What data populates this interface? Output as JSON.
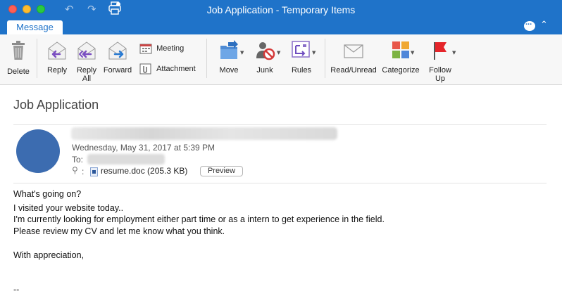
{
  "window": {
    "title": "Job Application - Temporary Items"
  },
  "titlebar_icons": {
    "undo": "undo-icon",
    "redo": "redo-icon",
    "print": "print-icon"
  },
  "tabs": [
    {
      "label": "Message"
    }
  ],
  "ribbon": {
    "delete": "Delete",
    "reply": "Reply",
    "reply_all_1": "Reply",
    "reply_all_2": "All",
    "forward": "Forward",
    "meeting": "Meeting",
    "attachment": "Attachment",
    "move": "Move",
    "junk": "Junk",
    "rules": "Rules",
    "read_unread": "Read/Unread",
    "categorize": "Categorize",
    "follow_up_1": "Follow",
    "follow_up_2": "Up"
  },
  "message": {
    "subject": "Job Application",
    "date": "Wednesday, May 31, 2017 at 5:39 PM",
    "to_label": "To:",
    "attachment_colon": ":",
    "attachment_name": "resume.doc (205.3 KB)",
    "preview_label": "Preview",
    "body": [
      "What's going on?",
      "I visited your website today..",
      "I'm currently looking for employment either part time or as a intern to get experience in the field.",
      "Please review my CV and let me know what you think.",
      "With appreciation,",
      "--"
    ]
  },
  "colors": {
    "titlebar": "#1f73c9",
    "avatar": "#3c6cb0",
    "flag": "#e5252a"
  }
}
